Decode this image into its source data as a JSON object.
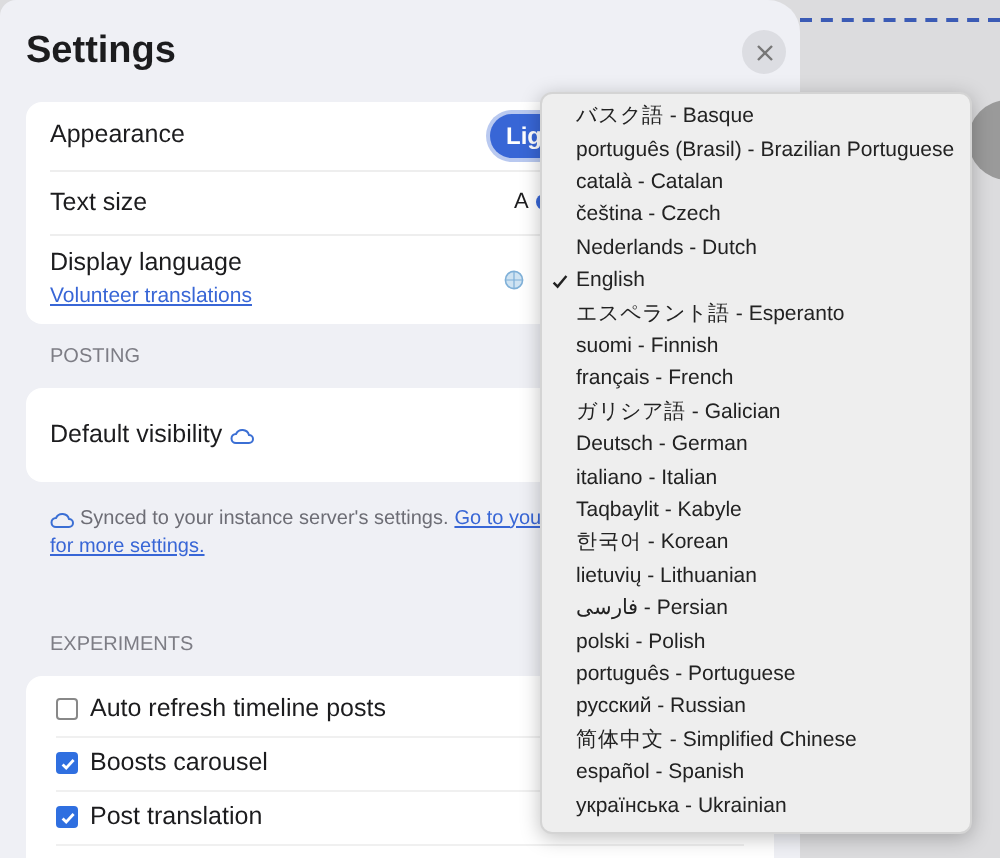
{
  "title": "Settings",
  "general": {
    "appearance": {
      "label": "Appearance",
      "button": "Lig"
    },
    "text_size": {
      "label": "Text size",
      "marker": "A"
    },
    "display_language": {
      "label": "Display language",
      "link": "Volunteer translations"
    }
  },
  "posting": {
    "heading": "POSTING",
    "default_visibility": "Default visibility",
    "note": "Synced to your instance server's settings.",
    "link_part_1": "Go to you",
    "link_part_2": "for more settings."
  },
  "experiments": {
    "heading": "EXPERIMENTS",
    "items": [
      {
        "label": "Auto refresh timeline posts",
        "checked": false
      },
      {
        "label": "Boosts carousel",
        "checked": true
      },
      {
        "label": "Post translation",
        "checked": true
      }
    ]
  },
  "language_menu": [
    {
      "label": "バスク語 - Basque",
      "selected": false
    },
    {
      "label": "português (Brasil) - Brazilian Portuguese",
      "selected": false
    },
    {
      "label": "català - Catalan",
      "selected": false
    },
    {
      "label": "čeština - Czech",
      "selected": false
    },
    {
      "label": "Nederlands - Dutch",
      "selected": false
    },
    {
      "label": "English",
      "selected": true
    },
    {
      "label": "エスペラント語 - Esperanto",
      "selected": false
    },
    {
      "label": "suomi - Finnish",
      "selected": false
    },
    {
      "label": "français - French",
      "selected": false
    },
    {
      "label": "ガリシア語 - Galician",
      "selected": false
    },
    {
      "label": "Deutsch - German",
      "selected": false
    },
    {
      "label": "italiano - Italian",
      "selected": false
    },
    {
      "label": "Taqbaylit - Kabyle",
      "selected": false
    },
    {
      "label": "한국어 - Korean",
      "selected": false
    },
    {
      "label": "lietuvių - Lithuanian",
      "selected": false
    },
    {
      "label": "فارسی - Persian",
      "selected": false
    },
    {
      "label": "polski - Polish",
      "selected": false
    },
    {
      "label": "português - Portuguese",
      "selected": false
    },
    {
      "label": "русский - Russian",
      "selected": false
    },
    {
      "label": "简体中文 - Simplified Chinese",
      "selected": false
    },
    {
      "label": "español - Spanish",
      "selected": false
    },
    {
      "label": "українська - Ukrainian",
      "selected": false
    }
  ]
}
